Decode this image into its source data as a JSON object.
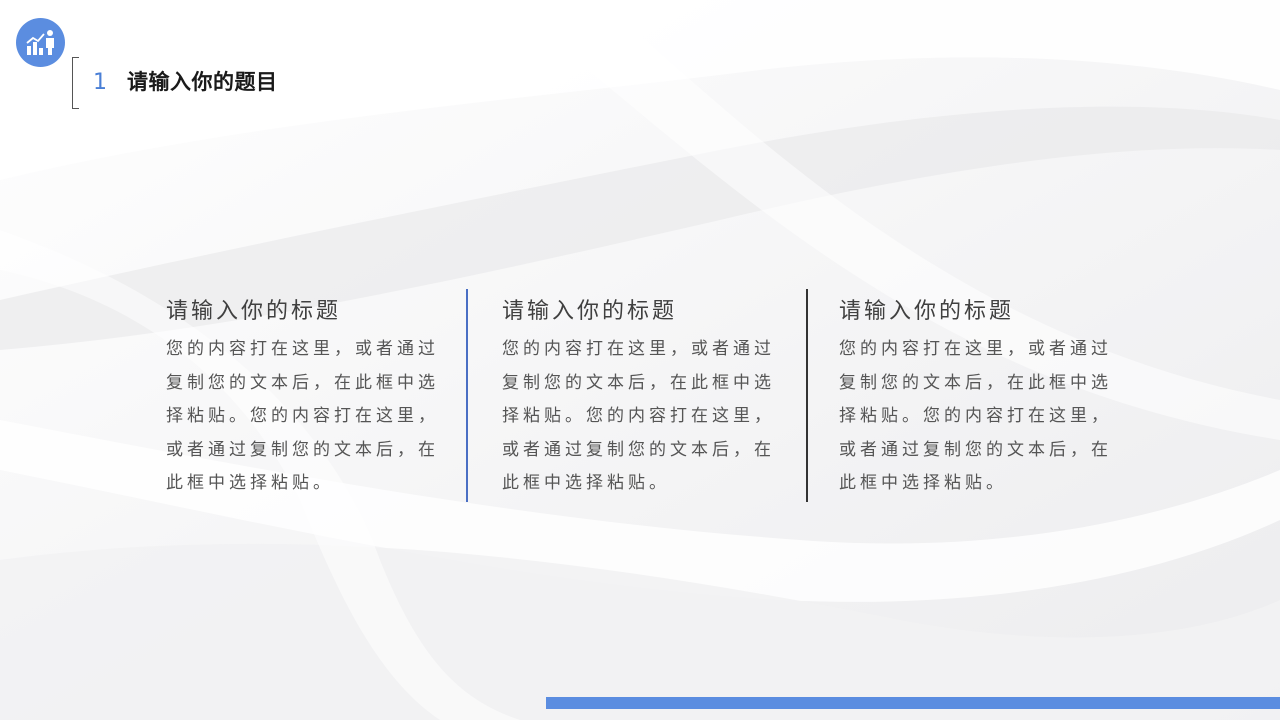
{
  "header": {
    "number": "1",
    "title": "请输入你的题目",
    "logo_icon": "chart-person-icon"
  },
  "columns": [
    {
      "heading": "请输入你的标题",
      "body": "您的内容打在这里，或者通过复制您的文本后，在此框中选择粘贴。您的内容打在这里，或者通过复制您的文本后，在此框中选择粘贴。"
    },
    {
      "heading": "请输入你的标题",
      "body": "您的内容打在这里，或者通过复制您的文本后，在此框中选择粘贴。您的内容打在这里，或者通过复制您的文本后，在此框中选择粘贴。"
    },
    {
      "heading": "请输入你的标题",
      "body": "您的内容打在这里，或者通过复制您的文本后，在此框中选择粘贴。您的内容打在这里，或者通过复制您的文本后，在此框中选择粘贴。"
    }
  ],
  "colors": {
    "accent": "#5b8de0",
    "number": "#4a7fd6",
    "divider_blue": "#4a6fc4",
    "divider_dark": "#333333"
  }
}
